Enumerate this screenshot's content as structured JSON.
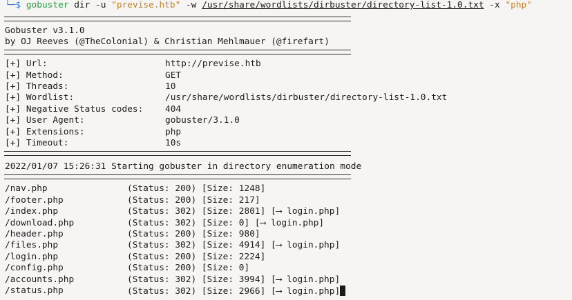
{
  "command": {
    "glyph": "└─$",
    "tool": "gobuster",
    "sub": "dir",
    "flag_u": "-u",
    "url_arg": "\"previse.htb\"",
    "flag_w": "-w",
    "wordlist_arg": "/usr/share/wordlists/dirbuster/directory-list-1.0.txt",
    "flag_x": "-x",
    "ext_arg": "\"php\""
  },
  "banner": {
    "version": "Gobuster v3.1.0",
    "authors": "by OJ Reeves (@TheColonial) & Christian Mehlmauer (@firefart)"
  },
  "config": [
    {
      "key": "[+] Url:",
      "value": "http://previse.htb"
    },
    {
      "key": "[+] Method:",
      "value": "GET"
    },
    {
      "key": "[+] Threads:",
      "value": "10"
    },
    {
      "key": "[+] Wordlist:",
      "value": "/usr/share/wordlists/dirbuster/directory-list-1.0.txt"
    },
    {
      "key": "[+] Negative Status codes:",
      "value": "404"
    },
    {
      "key": "[+] User Agent:",
      "value": "gobuster/3.1.0"
    },
    {
      "key": "[+] Extensions:",
      "value": "php"
    },
    {
      "key": "[+] Timeout:",
      "value": "10s"
    }
  ],
  "start_message": "2022/01/07 15:26:31 Starting gobuster in directory enumeration mode",
  "results": [
    {
      "path": "/nav.php",
      "info": "(Status: 200) [Size: 1248]"
    },
    {
      "path": "/footer.php",
      "info": "(Status: 200) [Size: 217]"
    },
    {
      "path": "/index.php",
      "info": "(Status: 302) [Size: 2801] [⟶ login.php]"
    },
    {
      "path": "/download.php",
      "info": "(Status: 302) [Size: 0] [⟶ login.php]"
    },
    {
      "path": "/header.php",
      "info": "(Status: 200) [Size: 980]"
    },
    {
      "path": "/files.php",
      "info": "(Status: 302) [Size: 4914] [⟶ login.php]"
    },
    {
      "path": "/login.php",
      "info": "(Status: 200) [Size: 2224]"
    },
    {
      "path": "/config.php",
      "info": "(Status: 200) [Size: 0]"
    },
    {
      "path": "/accounts.php",
      "info": "(Status: 302) [Size: 3994] [⟶ login.php]"
    },
    {
      "path": "/status.php",
      "info": "(Status: 302) [Size: 2966] [⟶ login.php]"
    }
  ]
}
